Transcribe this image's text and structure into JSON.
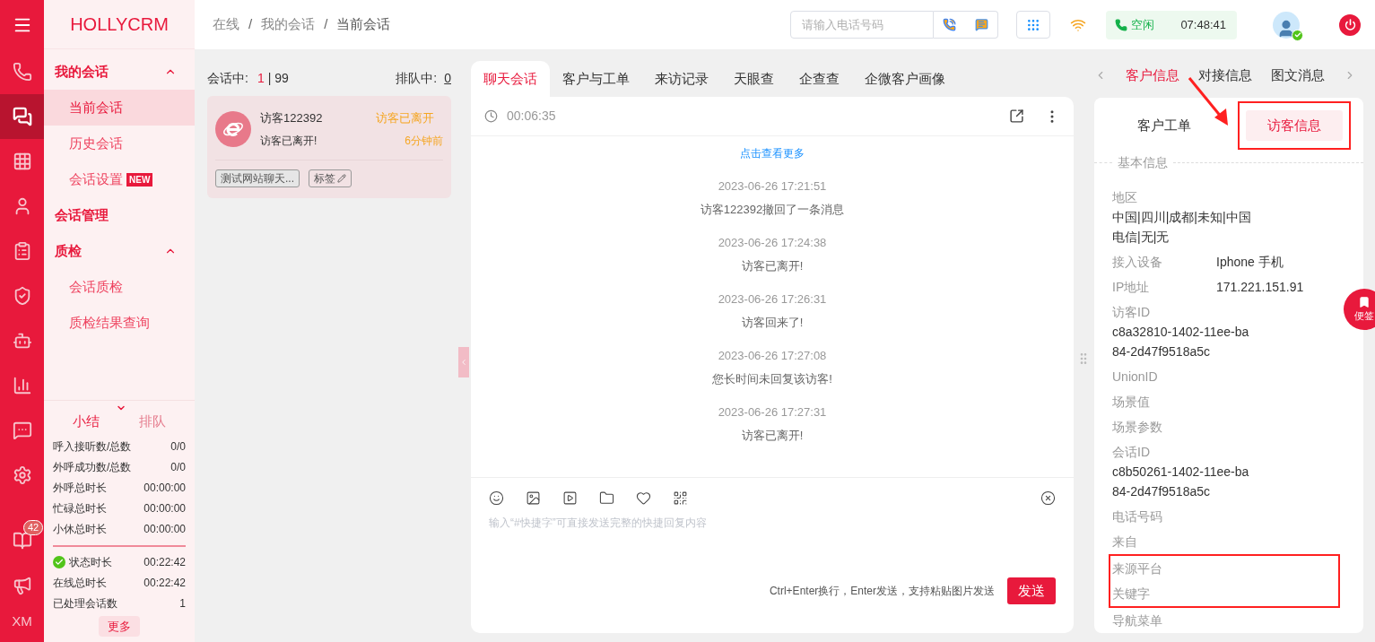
{
  "nav_rail": {
    "items": [
      {
        "selected": false
      },
      {
        "selected": true
      },
      {
        "selected": false
      },
      {
        "selected": false
      },
      {
        "selected": false
      },
      {
        "selected": false
      },
      {
        "selected": false
      },
      {
        "selected": false
      },
      {
        "selected": false
      },
      {
        "selected": false
      }
    ],
    "bottom_items": [
      {
        "badge": "42",
        "selected": false
      },
      {
        "selected": false
      }
    ],
    "user_initials": "XM"
  },
  "sidebar": {
    "logo": "HOLLYCRM",
    "menu": [
      {
        "label": "我的会话",
        "expanded": true,
        "children": [
          {
            "label": "当前会话",
            "selected": true
          },
          {
            "label": "历史会话",
            "selected": false
          },
          {
            "label": "会话设置",
            "selected": false,
            "badge": "NEW"
          }
        ]
      },
      {
        "label": "会话管理"
      },
      {
        "label": "质检",
        "expanded": true,
        "children": [
          {
            "label": "会话质检",
            "selected": false
          },
          {
            "label": "质检结果查询",
            "selected": false
          }
        ]
      }
    ],
    "summary_tabs": [
      {
        "label": "小结",
        "selected": true
      },
      {
        "label": "排队",
        "selected": false
      }
    ],
    "stats": [
      {
        "label": "呼入接听数/总数",
        "value": "0/0"
      },
      {
        "label": "外呼成功数/总数",
        "value": "0/0"
      },
      {
        "label": "外呼总时长",
        "value": "00:00:00"
      },
      {
        "label": "忙碌总时长",
        "value": "00:00:00"
      },
      {
        "label": "小休总时长",
        "value": "00:00:00"
      }
    ],
    "status_stats": [
      {
        "label": "状态时长",
        "value": "00:22:42",
        "kind": "status"
      },
      {
        "label": "在线总时长",
        "value": "00:22:42",
        "kind": "plain"
      },
      {
        "label": "已处理会话数",
        "value": "1",
        "kind": "plain"
      }
    ],
    "more_button": "更多"
  },
  "header": {
    "breadcrumb": [
      "在线",
      "我的会话",
      "当前会话"
    ],
    "breadcrumb_separator": "/",
    "phone_search": {
      "placeholder": "请输入电话号码"
    },
    "agent_status": {
      "label": "空闲",
      "time": "07:48:41"
    }
  },
  "sessions": {
    "active": {
      "label": "会话中:",
      "count": "1",
      "separator": "|",
      "capacity": "99"
    },
    "queue": {
      "label": "排队中:",
      "count": "0"
    },
    "items": [
      {
        "name": "访客122392",
        "status": "访客已离开",
        "last_message": "访客已离开!",
        "time": "6分钟前",
        "tags": [
          "测试网站聊天..."
        ],
        "tag_button": "标签",
        "selected": true
      }
    ]
  },
  "chat": {
    "tabs": [
      {
        "label": "聊天会话",
        "selected": true
      },
      {
        "label": "客户与工单",
        "selected": false
      },
      {
        "label": "来访记录",
        "selected": false
      },
      {
        "label": "天眼查",
        "selected": false
      },
      {
        "label": "企查查",
        "selected": false
      },
      {
        "label": "企微客户画像",
        "selected": false
      }
    ],
    "timer": "00:06:35",
    "load_more": "点击查看更多",
    "messages": [
      {
        "time": "2023-06-26 17:21:51",
        "text": "访客122392撤回了一条消息"
      },
      {
        "time": "2023-06-26 17:24:38",
        "text": "访客已离开!"
      },
      {
        "time": "2023-06-26 17:26:31",
        "text": "访客回来了!"
      },
      {
        "time": "2023-06-26 17:27:08",
        "text": "您长时间未回复该访客!"
      },
      {
        "time": "2023-06-26 17:27:31",
        "text": "访客已离开!"
      }
    ],
    "composer": {
      "placeholder": "输入“#快捷字”可直接发送完整的快捷回复内容",
      "hint": "Ctrl+Enter换行，Enter发送，支持粘贴图片发送",
      "send": "发送"
    }
  },
  "info_panel": {
    "tabs": [
      {
        "label": "客户信息",
        "selected": true
      },
      {
        "label": "对接信息",
        "selected": false
      },
      {
        "label": "图文消息",
        "selected": false
      }
    ],
    "sub_tabs": [
      {
        "label": "客户工单",
        "selected": false,
        "highlighted": false
      },
      {
        "label": "访客信息",
        "selected": true,
        "highlighted": true
      }
    ],
    "section_title": "基本信息",
    "fields": [
      {
        "label": "地区",
        "value": "中国|四川|成都|未知|中国电信|无|无",
        "kind": "stacked",
        "highlighted": false
      },
      {
        "label": "接入设备",
        "value": "Iphone 手机",
        "kind": "inline",
        "highlighted": false
      },
      {
        "label": "IP地址",
        "value": "171.221.151.91",
        "kind": "inline",
        "highlighted": false
      },
      {
        "label": "访客ID",
        "value": "c8a32810-1402-11ee-ba84-2d47f9518a5c",
        "kind": "stacked",
        "highlighted": false
      },
      {
        "label": "UnionID",
        "kind": "inline",
        "highlighted": false
      },
      {
        "label": "场景值",
        "kind": "inline",
        "highlighted": false
      },
      {
        "label": "场景参数",
        "kind": "inline",
        "highlighted": false
      },
      {
        "label": "会话ID",
        "value": "c8b50261-1402-11ee-ba84-2d47f9518a5c",
        "kind": "stacked",
        "highlighted": false
      },
      {
        "label": "电话号码",
        "kind": "inline",
        "highlighted": false
      },
      {
        "label": "来自",
        "kind": "inline",
        "highlighted": false
      },
      {
        "label": "来源平台",
        "kind": "inline",
        "highlighted": true
      },
      {
        "label": "关键字",
        "kind": "inline",
        "highlighted": true
      },
      {
        "label": "导航菜单",
        "kind": "inline",
        "highlighted": false
      }
    ],
    "note_button": "便签"
  }
}
